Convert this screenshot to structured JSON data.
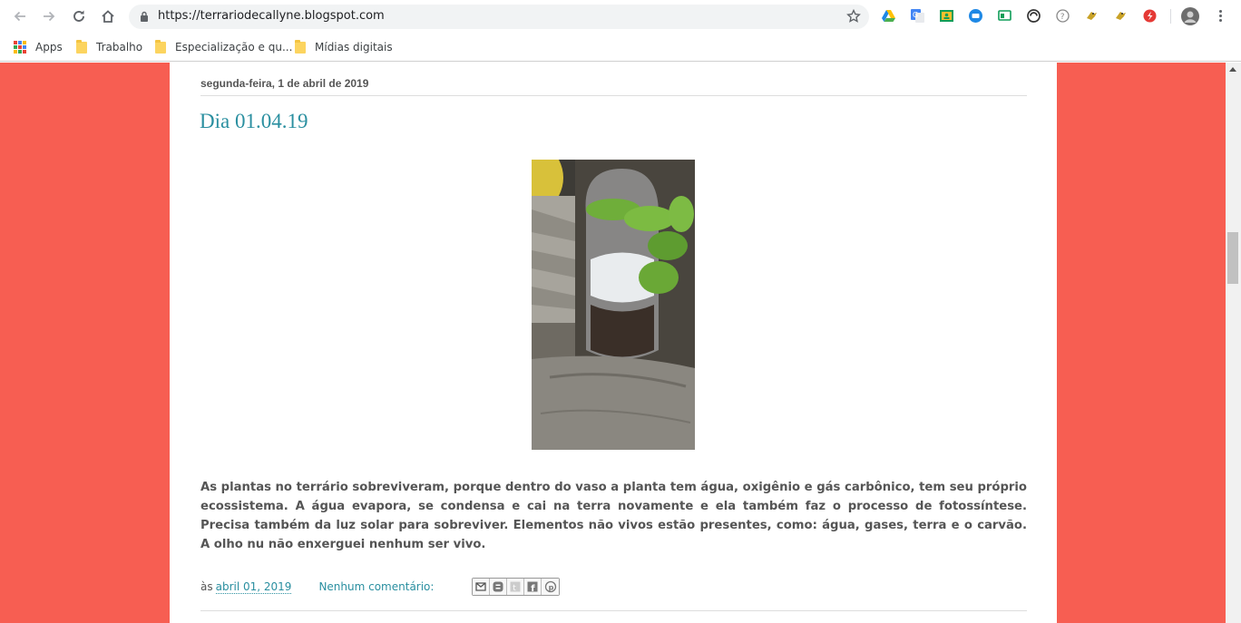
{
  "browser": {
    "url": "https://terrariodecallyne.blogspot.com",
    "bookmarks": [
      {
        "label": "Apps"
      },
      {
        "label": "Trabalho"
      },
      {
        "label": "Especialização e qu..."
      },
      {
        "label": "Mídias digitais"
      }
    ]
  },
  "post": {
    "date_header": "segunda-feira, 1 de abril de 2019",
    "title": "Dia 01.04.19",
    "image_alt": "plant in plastic bottle terrarium",
    "body": "As plantas no terrário sobreviveram, porque dentro do vaso a planta tem água, oxigênio e gás carbônico, tem seu próprio ecossistema. A água evapora, se condensa e cai na terra novamente e ela também faz o processo de fotossíntese. Precisa também da luz solar para sobreviver. Elementos não vivos estão presentes, como: água, gases, terra e o carvão. A olho nu não enxerguei nenhum ser vivo.",
    "footer": {
      "prefix": "às",
      "timestamp": "abril 01, 2019",
      "comments": "Nenhum comentário:"
    }
  },
  "colors": {
    "page_background": "#f75e52",
    "title_link": "#2a8fa0"
  }
}
